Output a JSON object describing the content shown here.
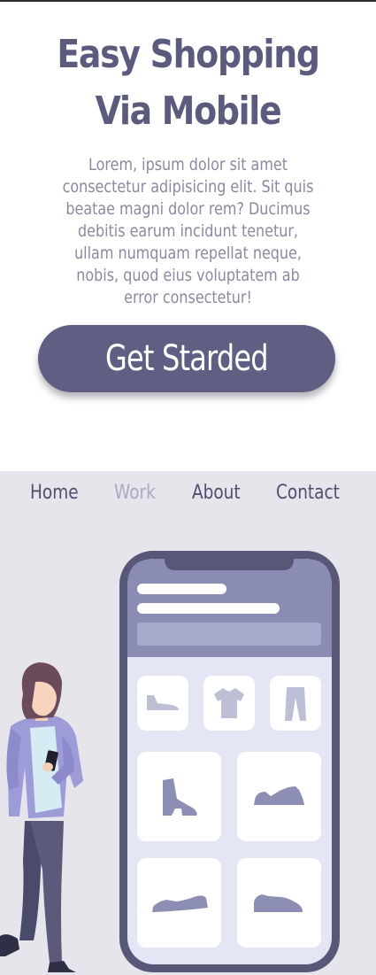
{
  "hero": {
    "title_line1": "Easy Shopping",
    "title_line2": "Via Mobile",
    "description": "Lorem, ipsum dolor sit amet consectetur adipisicing elit. Sit quis beatae magni dolor rem? Ducimus debitis earum incidunt tenetur, ullam numquam repellat neque, nobis, quod eius voluptatem ab error consectetur!",
    "cta_label": "Get Starded"
  },
  "nav": {
    "items": [
      {
        "label": "Home",
        "active": false
      },
      {
        "label": "Work",
        "active": true
      },
      {
        "label": "About",
        "active": false
      },
      {
        "label": "Contact",
        "active": false
      }
    ]
  },
  "colors": {
    "accent": "#5f5e83",
    "nav_text": "#4f4f72",
    "nav_active": "#a9a8c0",
    "section_bg": "#e6e5ec",
    "phone_header": "#8b8cb4",
    "phone_screen": "#e4e5f5"
  },
  "illustration": {
    "icons": [
      "shoe-icon",
      "tshirt-icon",
      "pants-icon",
      "boot-icon",
      "sneaker-icon",
      "sneaker-icon",
      "sneaker-icon"
    ]
  }
}
